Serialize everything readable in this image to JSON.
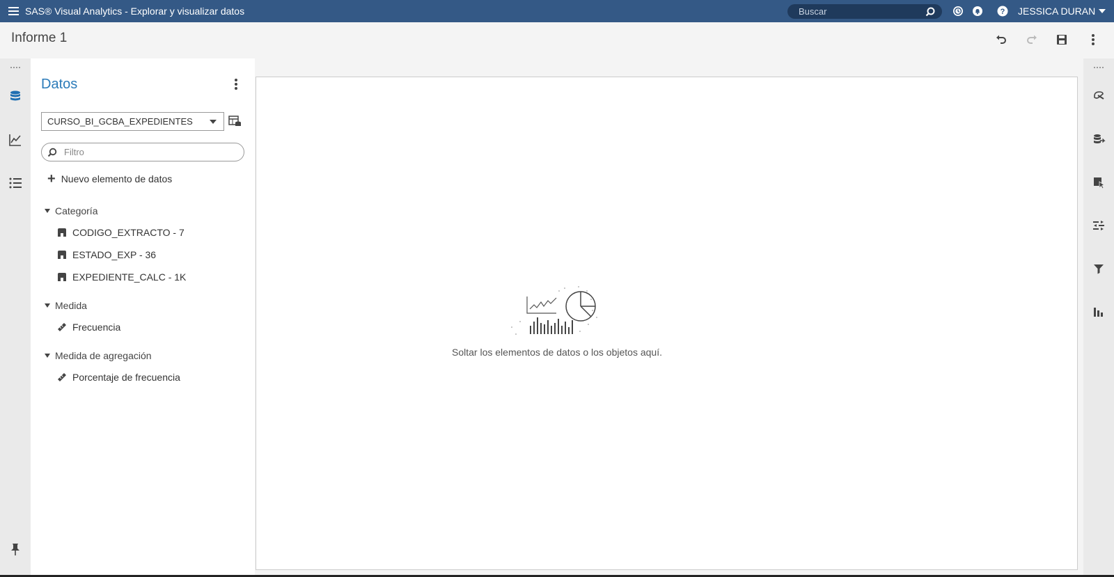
{
  "banner": {
    "app_title": "SAS® Visual Analytics - Explorar y visualizar datos",
    "search_placeholder": "Buscar",
    "user_name": "JESSICA DURAN",
    "bg_color": "#345986"
  },
  "report": {
    "title": "Informe 1"
  },
  "data_panel": {
    "title": "Datos",
    "data_source": "CURSO_BI_GCBA_EXPEDIENTES",
    "filter_placeholder": "Filtro",
    "new_item_label": "Nuevo elemento de datos",
    "groups": [
      {
        "label": "Categoría",
        "items": [
          {
            "label": "CODIGO_EXTRACTO - 7",
            "icon": "category-icon"
          },
          {
            "label": "ESTADO_EXP - 36",
            "icon": "category-icon"
          },
          {
            "label": "EXPEDIENTE_CALC - 1K",
            "icon": "category-icon"
          }
        ]
      },
      {
        "label": "Medida",
        "items": [
          {
            "label": "Frecuencia",
            "icon": "measure-icon"
          }
        ]
      },
      {
        "label": "Medida de agregación",
        "items": [
          {
            "label": "Porcentaje de frecuencia",
            "icon": "measure-icon"
          }
        ]
      }
    ],
    "accent_color": "#2b7bb9"
  },
  "canvas": {
    "drop_message": "Soltar los elementos de datos o los objetos aquí."
  },
  "left_rail_icons": [
    "data-icon",
    "objects-icon",
    "outline-icon",
    "pin-icon"
  ],
  "right_rail_icons": [
    "format-icon",
    "roles-icon",
    "actions-icon",
    "rules-icon",
    "filters-icon",
    "ranks-icon"
  ]
}
